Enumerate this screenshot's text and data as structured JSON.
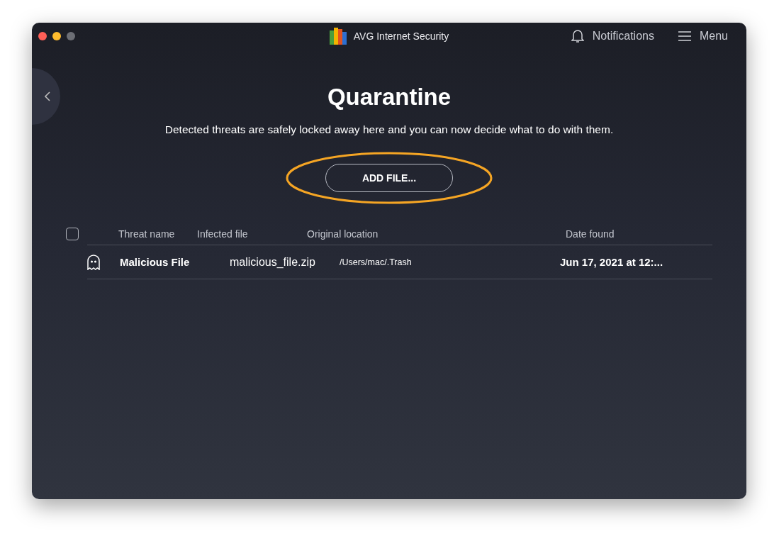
{
  "window": {
    "title": "AVG Internet Security"
  },
  "header": {
    "notifications": "Notifications",
    "menu": "Menu"
  },
  "page": {
    "title": "Quarantine",
    "subtitle": "Detected threats are safely locked away here and you can now decide what to do with them.",
    "add_button": "ADD FILE...",
    "add_button_highlighted": true
  },
  "table": {
    "select_all_checked": false,
    "columns": [
      "Threat name",
      "Infected file",
      "Original location",
      "Date found"
    ],
    "rows": [
      {
        "threat_name": "Malicious File",
        "infected_file": "malicious_file.zip",
        "original_location": "/Users/mac/.Trash",
        "date_found": "Jun 17, 2021 at 12:..."
      }
    ]
  }
}
